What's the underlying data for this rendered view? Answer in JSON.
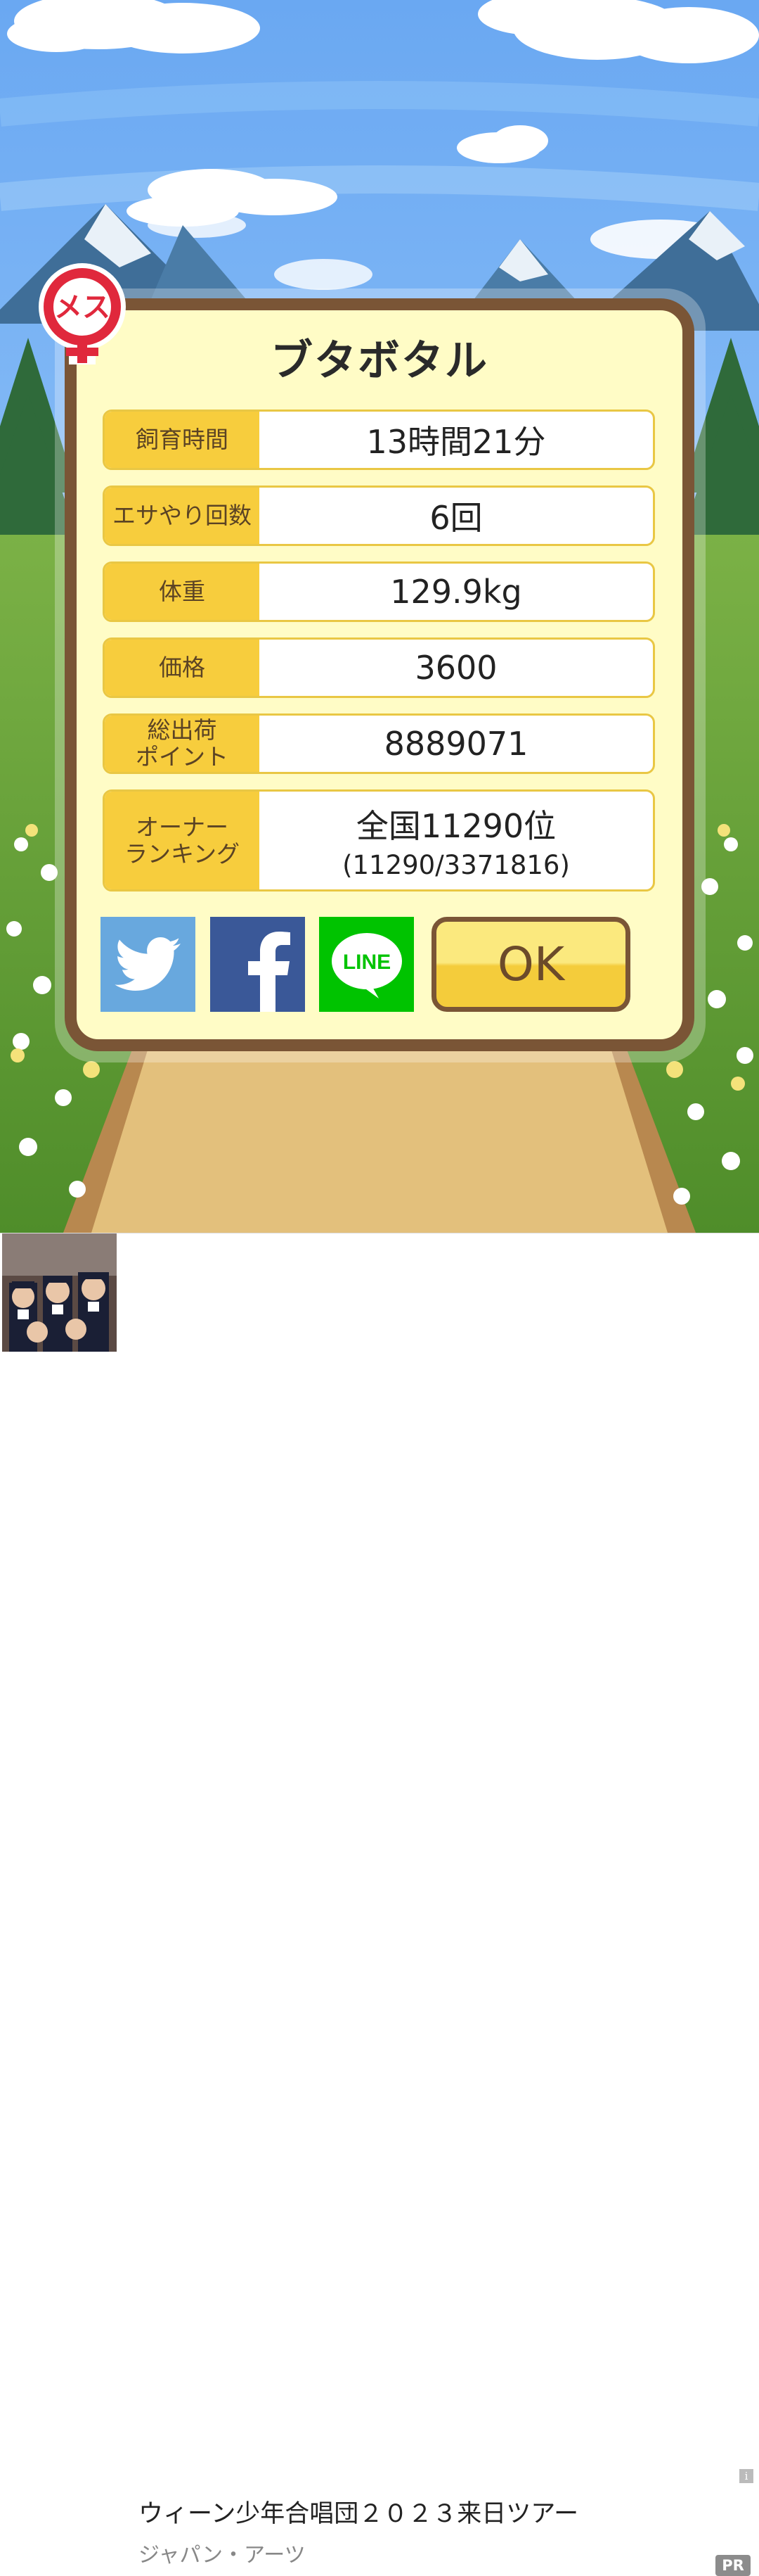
{
  "pig": {
    "name": "ブタボタル",
    "gender_badge": "メス"
  },
  "stats": [
    {
      "label": "飼育時間",
      "value": "13時間21分"
    },
    {
      "label": "エサやり回数",
      "value": "6回"
    },
    {
      "label": "体重",
      "value": "129.9kg"
    },
    {
      "label": "価格",
      "value": "3600"
    },
    {
      "label": "総出荷\nポイント",
      "value": "8889071"
    },
    {
      "label": "オーナー\nランキング",
      "value": "全国11290位",
      "sub_value": "(11290/3371816)"
    }
  ],
  "share": {
    "line_label": "LINE"
  },
  "ok_label": "OK",
  "ad": {
    "title": "ウィーン少年合唱団２０２３来日ツアー",
    "subtitle": "ジャパン・アーツ",
    "info": "i",
    "pr_badge": "PR"
  },
  "colors": {
    "frame_brown": "#7a5536",
    "panel_cream": "#fffcc6",
    "label_yellow": "#f7cd3d",
    "gender_red": "#e0283c",
    "twitter": "#68a8de",
    "facebook": "#3a5898",
    "line": "#00c300"
  },
  "icons": [
    "female-gender-icon",
    "twitter-bird-icon",
    "facebook-f-icon",
    "line-logo-icon",
    "ad-info-icon"
  ]
}
